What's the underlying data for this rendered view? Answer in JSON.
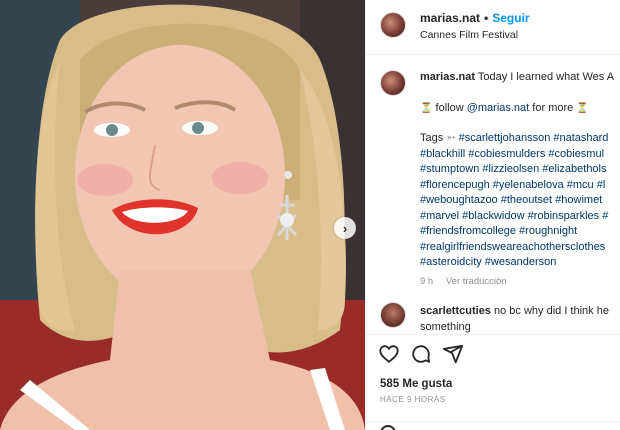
{
  "header": {
    "username": "marias.nat",
    "separator": "•",
    "follow_label": "Seguir",
    "location": "Cannes Film Festival"
  },
  "caption": {
    "username": "marias.nat",
    "line1": "Today I learned what Wes A",
    "follow_prefix": "follow",
    "mention": "@marias.nat",
    "follow_suffix": "for more",
    "hourglass": "⏳",
    "tags_label": "Tags",
    "tags_arrow": "➳",
    "tag_lines": [
      "#scarlettjohansson #natashard",
      "#blackhill #cobiesmulders #cobiesmul",
      "#stumptown #lizzieolsen #elizabethols",
      "#florencepugh #yelenabelova #mcu #l",
      "#weboughtazoo #theoutset #howimet",
      "#marvel #blackwidow #robinsparkles #",
      "#friendsfromcollege #roughnight",
      "#realgirlfriendsweareachothersclothes",
      "#asteroidcity #wesanderson"
    ],
    "time": "9 h",
    "translate_label": "Ver traducción"
  },
  "comment2": {
    "username": "scarlettcuties",
    "text": "no bc why did I think he",
    "text2": "something"
  },
  "actions": {
    "likes": "585 Me gusta",
    "timestamp": "HACE 9 HORAS"
  },
  "colors": {
    "link_blue": "#0095f6",
    "tag_blue": "#00376b",
    "muted": "#8e8e8e"
  }
}
